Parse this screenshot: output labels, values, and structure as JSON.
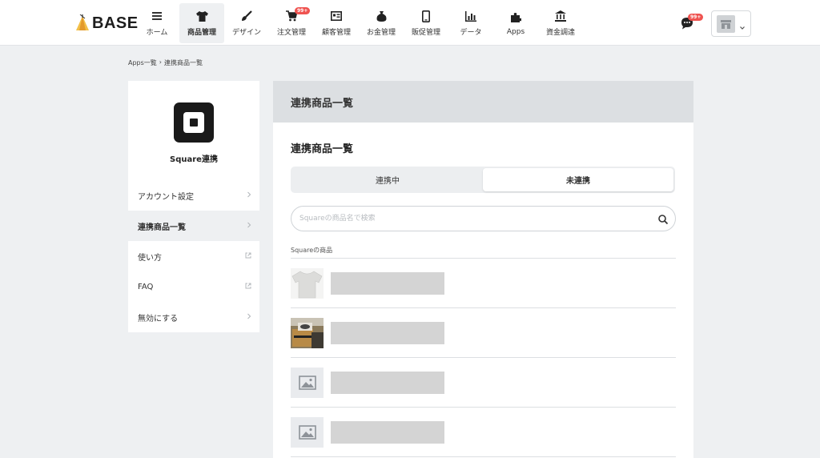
{
  "app": {
    "logo_text": "BASE"
  },
  "nav": {
    "items": [
      {
        "label": "ホーム",
        "icon": "home-list-icon"
      },
      {
        "label": "商品管理",
        "icon": "tshirt-icon",
        "active": true
      },
      {
        "label": "デザイン",
        "icon": "brush-icon"
      },
      {
        "label": "注文管理",
        "icon": "cart-icon",
        "badge": "99+"
      },
      {
        "label": "顧客管理",
        "icon": "customer-card-icon"
      },
      {
        "label": "お金管理",
        "icon": "money-bag-icon"
      },
      {
        "label": "販促管理",
        "icon": "smartphone-icon"
      },
      {
        "label": "データ",
        "icon": "bar-chart-icon"
      },
      {
        "label": "Apps",
        "icon": "puzzle-icon"
      },
      {
        "label": "資金調達",
        "icon": "bank-icon"
      }
    ],
    "message_badge": "99+"
  },
  "breadcrumb": {
    "parent": "Apps一覧",
    "separator": "›",
    "current": "連携商品一覧"
  },
  "side": {
    "title": "Square連携",
    "menu": [
      {
        "label": "アカウント設定",
        "icon": "chevron-right-icon"
      },
      {
        "label": "連携商品一覧",
        "icon": "chevron-right-icon",
        "active": true
      },
      {
        "label": "使い方",
        "icon": "external-link-icon"
      },
      {
        "label": "FAQ",
        "icon": "external-link-icon"
      },
      {
        "label": "無効にする",
        "icon": "chevron-right-icon"
      }
    ]
  },
  "main": {
    "header_title": "連携商品一覧",
    "section_title": "連携商品一覧",
    "tabs": [
      {
        "label": "連携中"
      },
      {
        "label": "未連携",
        "active": true
      }
    ],
    "search_placeholder": "Squareの商品名で検索",
    "list_label": "Squareの商品",
    "products": [
      {
        "thumbnail": "tshirt-photo"
      },
      {
        "thumbnail": "box-photo"
      },
      {
        "thumbnail": "image-placeholder-icon"
      },
      {
        "thumbnail": "image-placeholder-icon"
      }
    ]
  },
  "colors": {
    "accent_badge": "#ef5350",
    "page_bg": "#eef0f2",
    "header_band": "#dcdfe2"
  }
}
